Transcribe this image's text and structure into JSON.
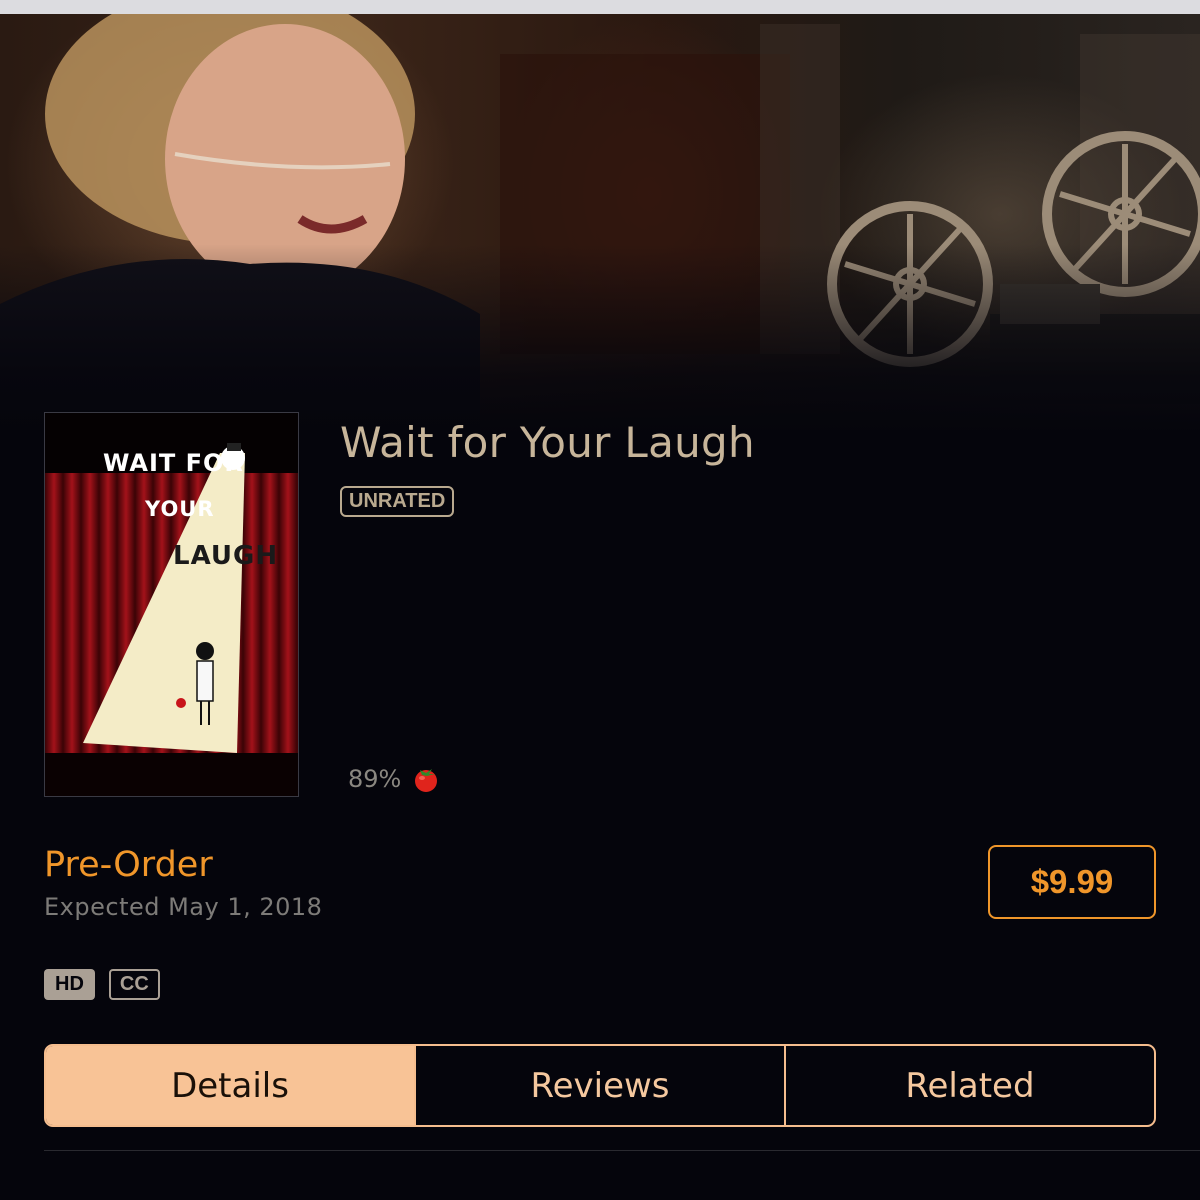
{
  "movie": {
    "title": "Wait for Your Laugh",
    "content_rating": "UNRATED",
    "critic_score": "89%",
    "critic_score_icon": "tomato-icon"
  },
  "poster": {
    "line1": "WAIT FOR",
    "line2": "YOUR",
    "line3": "LAUGH"
  },
  "purchase": {
    "status_label": "Pre-Order",
    "expected_text": "Expected May 1, 2018",
    "price_label": "$9.99"
  },
  "format_badges": {
    "hd": "HD",
    "cc": "CC"
  },
  "tabs": [
    {
      "label": "Details",
      "active": true
    },
    {
      "label": "Reviews",
      "active": false
    },
    {
      "label": "Related",
      "active": false
    }
  ],
  "colors": {
    "accent": "#f0962a",
    "title": "#c7b59a",
    "tab_active_bg": "#f8c396",
    "background": "#05050c"
  }
}
